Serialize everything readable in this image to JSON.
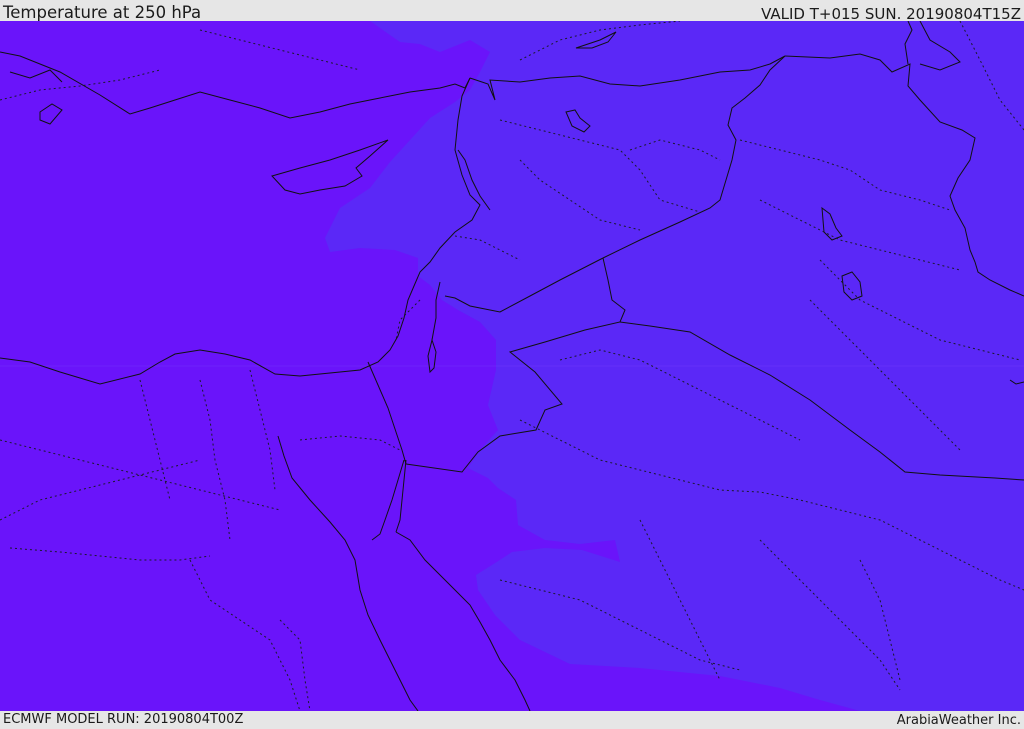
{
  "header": {
    "title": "Temperature at 250 hPa",
    "valid_time": "VALID T+015 SUN. 20190804T15Z"
  },
  "footer": {
    "model_run": "ECMWF MODEL RUN: 20190804T00Z",
    "credit": "ArabiaWeather Inc."
  },
  "map": {
    "colors": {
      "cold_fill": "#6a14fa",
      "warm_fill": "#5b28f7",
      "coastline": "#111111",
      "border_dotted": "#1a1a2a"
    }
  }
}
